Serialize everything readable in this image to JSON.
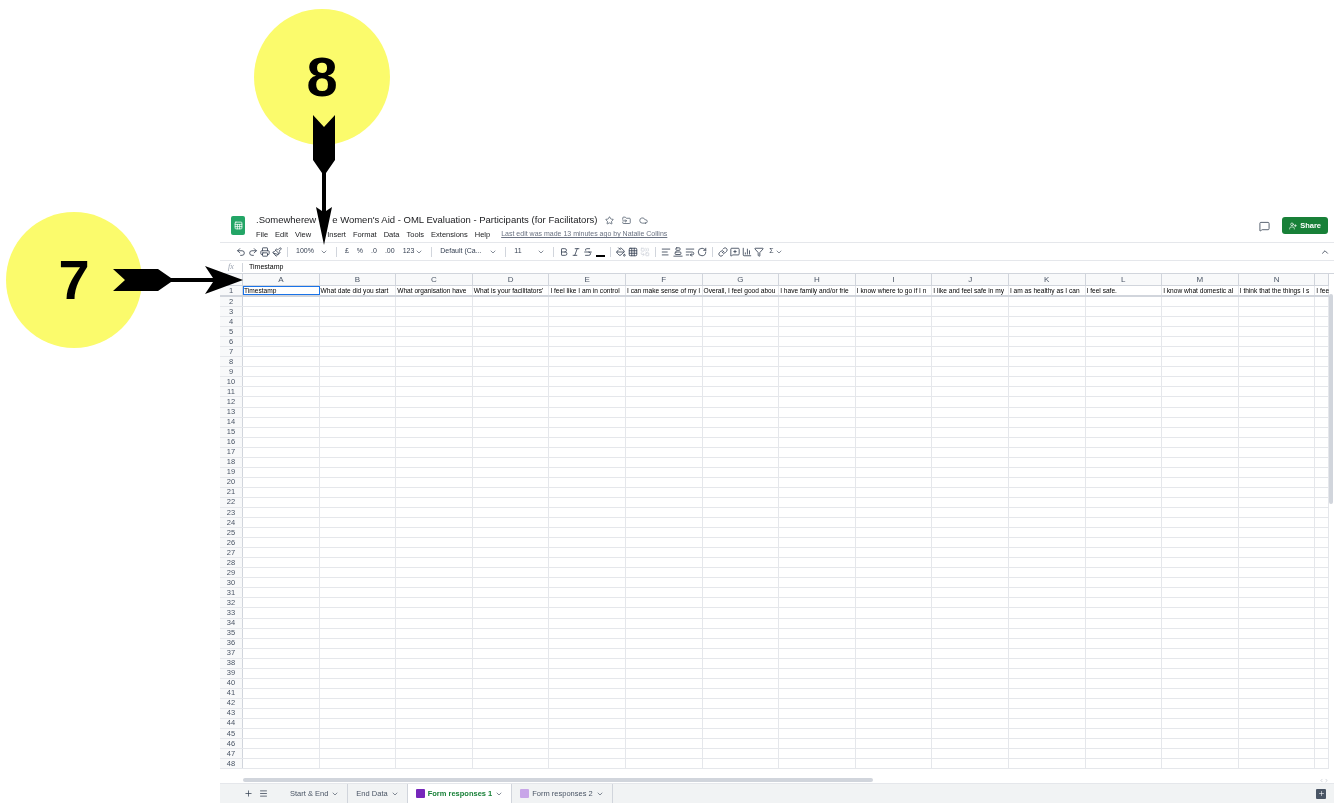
{
  "callouts": [
    {
      "label": "8",
      "kind": "down"
    },
    {
      "label": "7",
      "kind": "right"
    }
  ],
  "doc": {
    "title_start": ".Somewherew",
    "title_end": "e Women's Aid - OML Evaluation - Participants (for Facilitators)",
    "last_edit": "Last edit was made 13 minutes ago by Natalie Collins"
  },
  "menu": [
    "File",
    "Edit",
    "View",
    "Insert",
    "Format",
    "Data",
    "Tools",
    "Extensions",
    "Help"
  ],
  "share_button": "Share",
  "toolbar": {
    "zoom": "100%",
    "currency": "£",
    "percent": "%",
    "decrease_decimals": ".0",
    "increase_decimals": ".00",
    "number_format": "123",
    "font": "Default (Ca...",
    "font_size": "11",
    "sum": "Σ"
  },
  "formula_bar": {
    "fx": "fx",
    "value": "Timestamp"
  },
  "columns": [
    {
      "letter": "A",
      "cell": "Timestamp",
      "selected": true
    },
    {
      "letter": "B",
      "cell": "What date did you start",
      "selected": false
    },
    {
      "letter": "C",
      "cell": "What organisation have",
      "selected": false
    },
    {
      "letter": "D",
      "cell": "What is your facilitators'",
      "selected": false
    },
    {
      "letter": "E",
      "cell": "I feel like I am in control",
      "selected": false
    },
    {
      "letter": "F",
      "cell": "I can make sense of my l",
      "selected": false
    },
    {
      "letter": "G",
      "cell": "Overall, I feel good abou",
      "selected": false
    },
    {
      "letter": "H",
      "cell": "I have family and/or frie",
      "selected": false
    },
    {
      "letter": "I",
      "cell": "I know where to go if I n",
      "selected": false
    },
    {
      "letter": "J",
      "cell": "I like and feel safe in my",
      "selected": false
    },
    {
      "letter": "K",
      "cell": "I am as healthy as I can",
      "selected": false
    },
    {
      "letter": "L",
      "cell": "I feel safe.",
      "selected": false
    },
    {
      "letter": "M",
      "cell": "I know what domestic al",
      "selected": false
    },
    {
      "letter": "N",
      "cell": "I think that the things I s",
      "selected": false
    },
    {
      "cell": "I fee",
      "selected": false
    }
  ],
  "row_numbers": [
    "1",
    "2",
    "3",
    "4",
    "5",
    "6",
    "7",
    "8",
    "9",
    "10",
    "11",
    "12",
    "13",
    "14",
    "15",
    "16",
    "17",
    "18",
    "19",
    "20",
    "21",
    "22",
    "23",
    "24",
    "25",
    "26",
    "27",
    "28",
    "29",
    "30",
    "31",
    "32",
    "33",
    "34",
    "35",
    "36",
    "37",
    "38",
    "39",
    "40",
    "41",
    "42",
    "43",
    "44",
    "45",
    "46",
    "47",
    "48"
  ],
  "sheet_tabs": [
    {
      "label": "Start & End",
      "kind": "plain",
      "selected": false
    },
    {
      "label": "End Data",
      "kind": "plain",
      "selected": false
    },
    {
      "label": "Form responses 1",
      "kind": "form",
      "selected": true
    },
    {
      "label": "Form responses 2",
      "kind": "form",
      "selected": false
    }
  ]
}
